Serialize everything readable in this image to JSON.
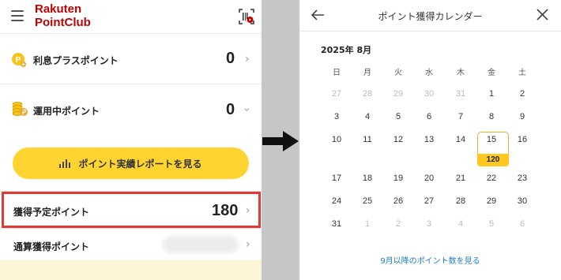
{
  "left": {
    "brand_line1": "Rakuten",
    "brand_line2": "PointClub",
    "rows": [
      {
        "label": "利息プラスポイント",
        "value": "0"
      },
      {
        "label": "運用中ポイント",
        "value": "0"
      },
      {
        "label": "獲得予定ポイント",
        "value": "180"
      },
      {
        "label": "通算獲得ポイント",
        "value": ""
      }
    ],
    "report_button": "ポイント実績レポートを見る",
    "icon_p_letter": "P"
  },
  "right": {
    "title": "ポイント獲得カレンダー",
    "month": "2025年 8月",
    "weekdays": [
      "日",
      "月",
      "火",
      "水",
      "木",
      "金",
      "土"
    ],
    "weeks": [
      [
        "27",
        "28",
        "29",
        "30",
        "31",
        "1",
        "2"
      ],
      [
        "3",
        "4",
        "5",
        "6",
        "7",
        "8",
        "9"
      ],
      [
        "10",
        "11",
        "12",
        "13",
        "14",
        "15",
        "16"
      ],
      [
        "17",
        "18",
        "19",
        "20",
        "21",
        "22",
        "23"
      ],
      [
        "24",
        "25",
        "26",
        "27",
        "28",
        "29",
        "30"
      ],
      [
        "31",
        "1",
        "2",
        "3",
        "4",
        "5",
        "6"
      ]
    ],
    "points_badge": "120",
    "more_link": "9月以降のポイント数を見る"
  },
  "colors": {
    "brand_red": "#bf0000",
    "accent_yellow": "#ffd330",
    "highlight_red": "#e53935",
    "link_blue": "#1d7fbf"
  }
}
